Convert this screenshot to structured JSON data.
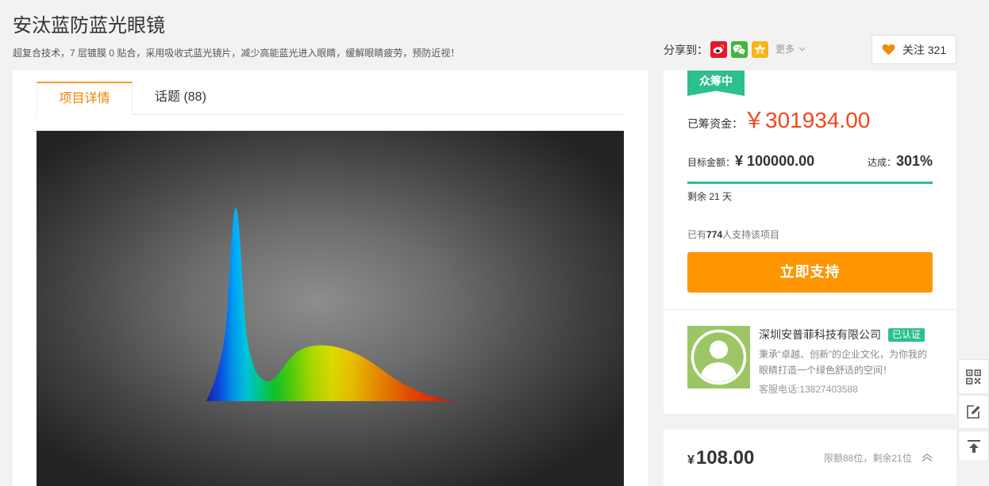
{
  "header": {
    "title": "安汰蓝防蓝光眼镜",
    "subtitle": "超复合技术，7 层镀膜 0 贴合，采用吸收式蓝光镜片，减少高能蓝光进入眼睛，缓解眼睛疲劳，预防近视！"
  },
  "share": {
    "label": "分享到：",
    "icons": [
      "weibo-icon",
      "wechat-icon",
      "qzone-icon"
    ],
    "more_label": "更多",
    "more_icon": "chevron-down-icon"
  },
  "follow": {
    "icon": "heart-icon",
    "label": "关注",
    "count": "321"
  },
  "tabs": [
    {
      "label": "项目详情",
      "active": true
    },
    {
      "label": "话题 (88)",
      "active": false
    }
  ],
  "funding": {
    "status_badge": "众筹中",
    "raised_label": "已筹资金：",
    "raised_amount": "￥301934.00",
    "target_label": "目标金额：",
    "target_amount": "¥ 100000.00",
    "achieved_label": "达成：",
    "achieved_value": "301%",
    "progress_fill": 1.0,
    "remaining": "剩余 21 天",
    "supporters_prefix": "已有",
    "supporters_count": "774",
    "supporters_suffix": "人支持该项目",
    "support_button": "立即支持"
  },
  "company": {
    "avatar_icon": "user-avatar-icon",
    "name": "深圳安普菲科技有限公司",
    "verified_badge": "已认证",
    "description": "秉承“卓越、创新”的企业文化，为你我的眼睛打造一个绿色舒适的空间！",
    "phone": "客服电话:13827403588"
  },
  "reward": {
    "currency": "¥",
    "price": "108.00",
    "limit": "限额88位，剩余21位",
    "toggle_icon": "chevron-up-icon"
  },
  "toolbar": {
    "icons": [
      "qr-code-icon",
      "edit-icon",
      "back-to-top-icon"
    ]
  },
  "colors": {
    "page_background": "#f2f2f2",
    "accent_orange": "#f08200",
    "tab_active_border": "#f59a23",
    "support_button": "#ff9500",
    "raised_amount": "#f0461e",
    "success_green": "#2dbf8c",
    "heart": "#f08c00",
    "avatar_background": "#9cc666"
  }
}
